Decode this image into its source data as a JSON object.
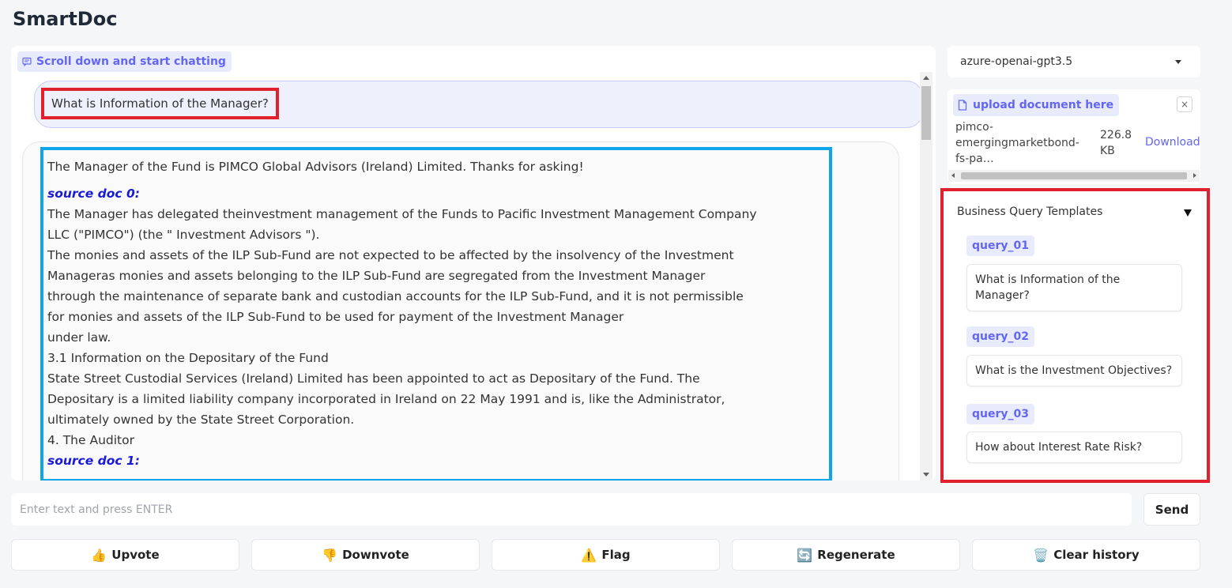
{
  "app": {
    "title": "SmartDoc"
  },
  "chat": {
    "label": "Scroll down and start chatting",
    "user_message": "What is Information of the Manager?",
    "bot_lines": [
      {
        "text": "The Manager of the Fund is PIMCO Global Advisors (Ireland) Limited. Thanks for asking!",
        "kind": "text"
      },
      {
        "text": "source doc 0:",
        "kind": "source"
      },
      {
        "text": "The Manager has delegated theinvestment management of the Funds to Pacific Investment Management Company",
        "kind": "text"
      },
      {
        "text": "LLC (\"PIMCO\") (the \" Investment Advisors \").",
        "kind": "text"
      },
      {
        "text": "The monies and assets of the ILP Sub-Fund are not expected to be affected by the insolvency of the Investment",
        "kind": "text"
      },
      {
        "text": "Manageras monies and assets belonging to the ILP Sub-Fund are segregated from the Investment Manager",
        "kind": "text"
      },
      {
        "text": "through the maintenance of separate bank and custodian accounts for the ILP Sub-Fund, and it is not permissible",
        "kind": "text"
      },
      {
        "text": "for monies and assets of the ILP Sub-Fund to be used for payment of the Investment Manager",
        "kind": "text"
      },
      {
        "text": "under law.",
        "kind": "text"
      },
      {
        "text": "3.1 Information on the Depositary of the Fund",
        "kind": "text"
      },
      {
        "text": "State Street Custodial Services (Ireland) Limited has been appointed to act as Depositary of the Fund. The",
        "kind": "text"
      },
      {
        "text": "Depositary is a limited liability company incorporated in Ireland on 22 May 1991 and is, like the Administrator,",
        "kind": "text"
      },
      {
        "text": "ultimately owned by the State Street Corporation.",
        "kind": "text"
      },
      {
        "text": "4. The Auditor",
        "kind": "text"
      },
      {
        "text": "source doc 1:",
        "kind": "source"
      }
    ]
  },
  "input": {
    "placeholder": "Enter text and press ENTER",
    "value": ""
  },
  "send_label": "Send",
  "actions": [
    {
      "label": "Upvote",
      "icon": "👍",
      "icon_name": "thumbs-up-icon"
    },
    {
      "label": "Downvote",
      "icon": "👎",
      "icon_name": "thumbs-down-icon"
    },
    {
      "label": "Flag",
      "icon": "⚠️",
      "icon_name": "warning-icon"
    },
    {
      "label": "Regenerate",
      "icon": "🔄",
      "icon_name": "refresh-icon"
    },
    {
      "label": "Clear history",
      "icon": "🗑️",
      "icon_name": "trash-icon"
    }
  ],
  "model_selector": {
    "value": "azure-openai-gpt3.5"
  },
  "upload": {
    "label": "upload document here",
    "close": "×",
    "file": {
      "name": "pimco-emergingmarketbond-fs-pa…",
      "size": "226.8 KB",
      "download": "Download"
    }
  },
  "templates": {
    "title": "Business Query Templates",
    "queries": [
      {
        "label": "query_01",
        "text": "What is Information of the Manager?"
      },
      {
        "label": "query_02",
        "text": "What is the Investment Objectives?"
      },
      {
        "label": "query_03",
        "text": "How about Interest Rate Risk?"
      }
    ]
  },
  "colors": {
    "accent": "#6366f1",
    "highlight_red": "#e0202c",
    "highlight_blue": "#0ea5e9",
    "source_label": "#1a1ad6"
  }
}
